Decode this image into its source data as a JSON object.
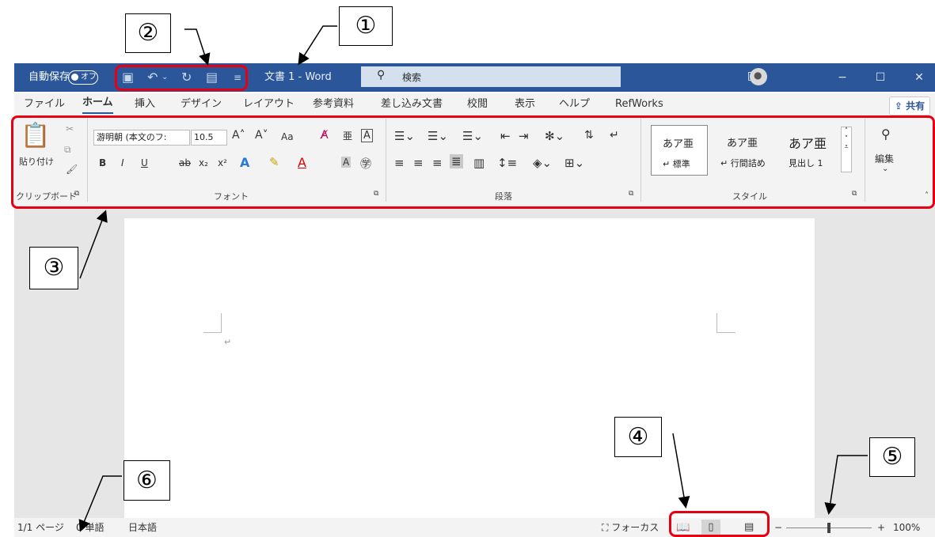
{
  "titlebar": {
    "autosave_label": "自動保存",
    "autosave_state": "オフ",
    "doc_title": "文書 1  -  Word",
    "search_placeholder": "検索",
    "qat_icons": [
      "save-icon",
      "undo-icon",
      "redo-icon",
      "touch-mode-icon",
      "customize-icon"
    ],
    "window_controls": [
      "ribbon-display-icon",
      "minimize-icon",
      "maximize-icon",
      "close-icon"
    ]
  },
  "ribbon": {
    "tabs": [
      "ファイル",
      "ホーム",
      "挿入",
      "デザイン",
      "レイアウト",
      "参考資料",
      "差し込み文書",
      "校閲",
      "表示",
      "ヘルプ",
      "RefWorks"
    ],
    "active_tab": "ホーム",
    "share_label": "共有",
    "clipboard": {
      "paste_label": "貼り付け",
      "group_label": "クリップボード"
    },
    "font": {
      "font_name": "游明朝 (本文のフ:",
      "font_size": "10.5",
      "change_case": "Aa",
      "group_label": "フォント"
    },
    "paragraph": {
      "group_label": "段落"
    },
    "styles": {
      "group_label": "スタイル",
      "items": [
        {
          "preview": "あア亜",
          "name": "標準"
        },
        {
          "preview": "あア亜",
          "name": "行間詰め"
        },
        {
          "preview": "あア亜",
          "name": "見出し 1"
        }
      ]
    },
    "editing": {
      "label": "編集"
    }
  },
  "statusbar": {
    "page": "1/1 ページ",
    "words": "0 単語",
    "language": "日本語",
    "focus": "フォーカス",
    "zoom_minus": "−",
    "zoom_plus": "+",
    "zoom": "100%",
    "zoom_level": 1.0
  },
  "annotations": {
    "n1": "①",
    "n2": "②",
    "n3": "③",
    "n4": "④",
    "n5": "⑤",
    "n6": "⑥"
  },
  "colors": {
    "titlebar": "#2b579a",
    "annotation": "#e60012"
  }
}
